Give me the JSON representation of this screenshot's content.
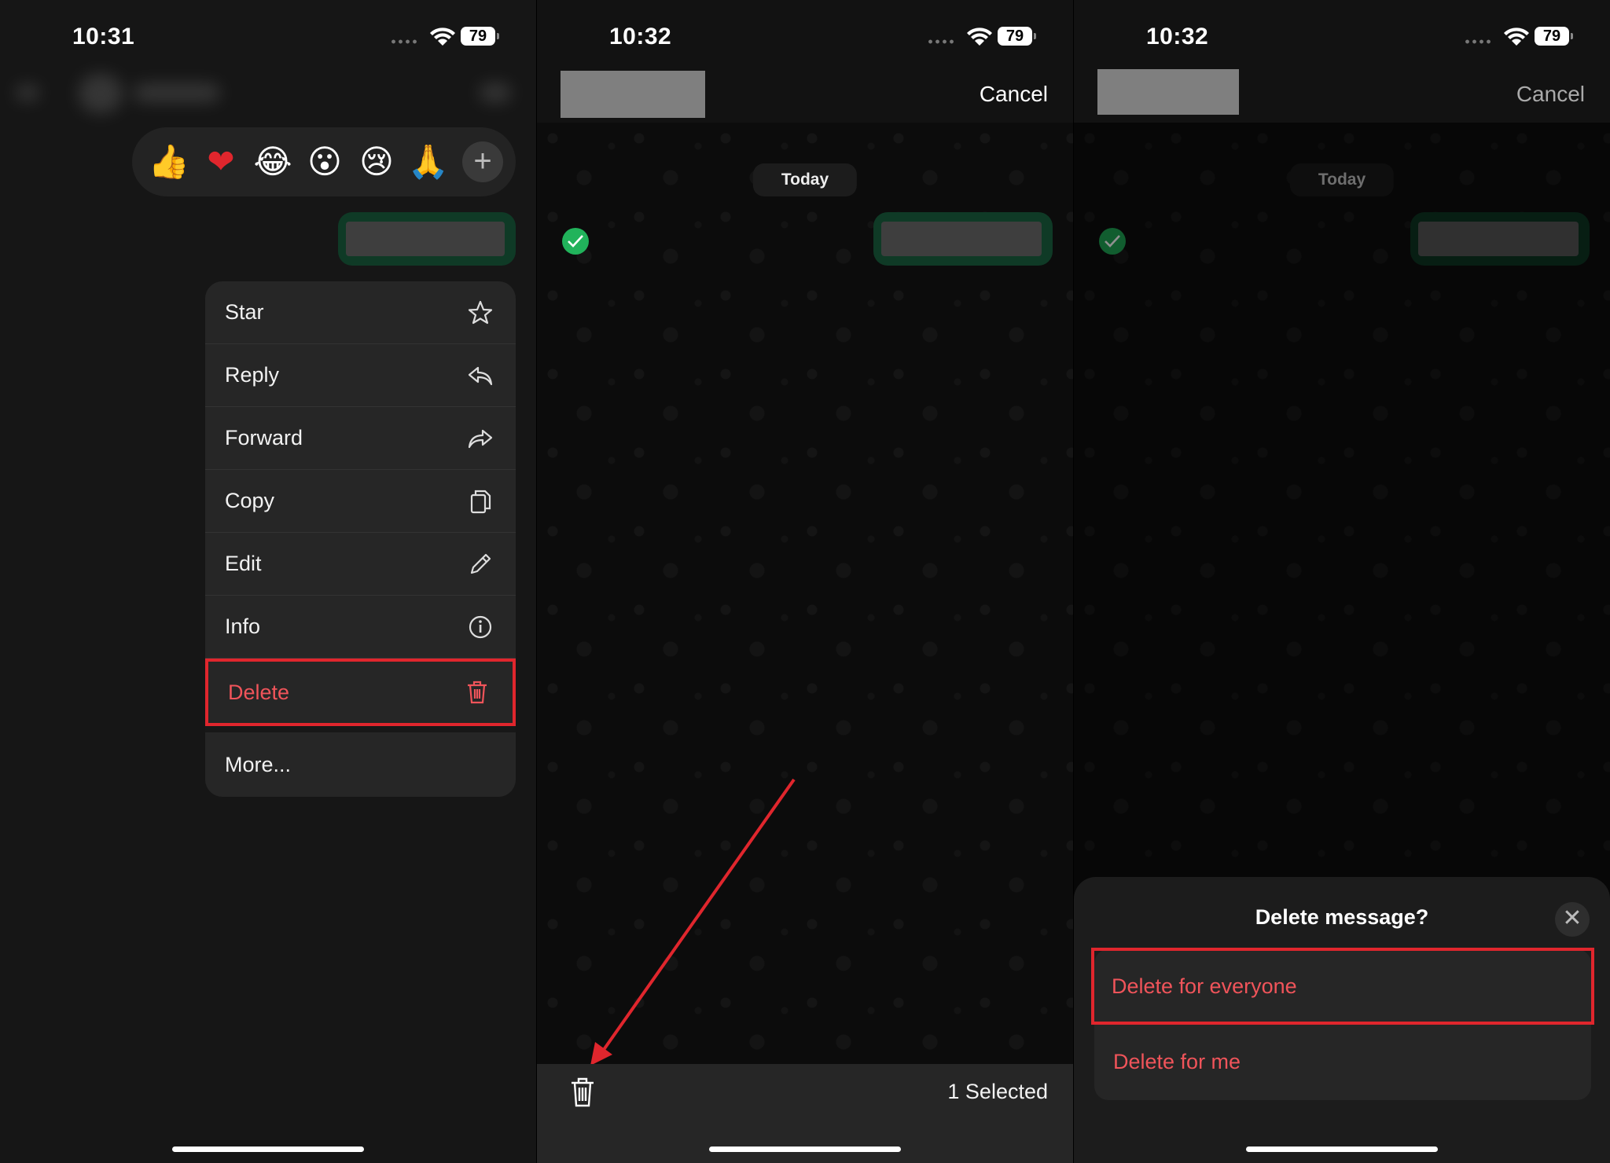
{
  "panel1": {
    "time": "10:31",
    "battery": "79",
    "reactions": [
      "👍",
      "❤",
      "😂",
      "😮",
      "😢",
      "🙏"
    ],
    "menu": [
      {
        "label": "Star",
        "icon": "star-icon"
      },
      {
        "label": "Reply",
        "icon": "reply-icon"
      },
      {
        "label": "Forward",
        "icon": "forward-icon"
      },
      {
        "label": "Copy",
        "icon": "copy-icon"
      },
      {
        "label": "Edit",
        "icon": "pencil-icon"
      },
      {
        "label": "Info",
        "icon": "info-icon"
      },
      {
        "label": "Delete",
        "icon": "trash-icon"
      }
    ],
    "more_label": "More..."
  },
  "panel2": {
    "time": "10:32",
    "battery": "79",
    "cancel": "Cancel",
    "date_chip": "Today",
    "selected_text": "1 Selected"
  },
  "panel3": {
    "time": "10:32",
    "battery": "79",
    "cancel": "Cancel",
    "date_chip": "Today",
    "sheet_title": "Delete message?",
    "option_everyone": "Delete for everyone",
    "option_me": "Delete for me"
  },
  "colors": {
    "danger": "#f0545a",
    "highlight": "#e0262d",
    "check": "#21b35b",
    "bubble": "#0f3a26"
  }
}
